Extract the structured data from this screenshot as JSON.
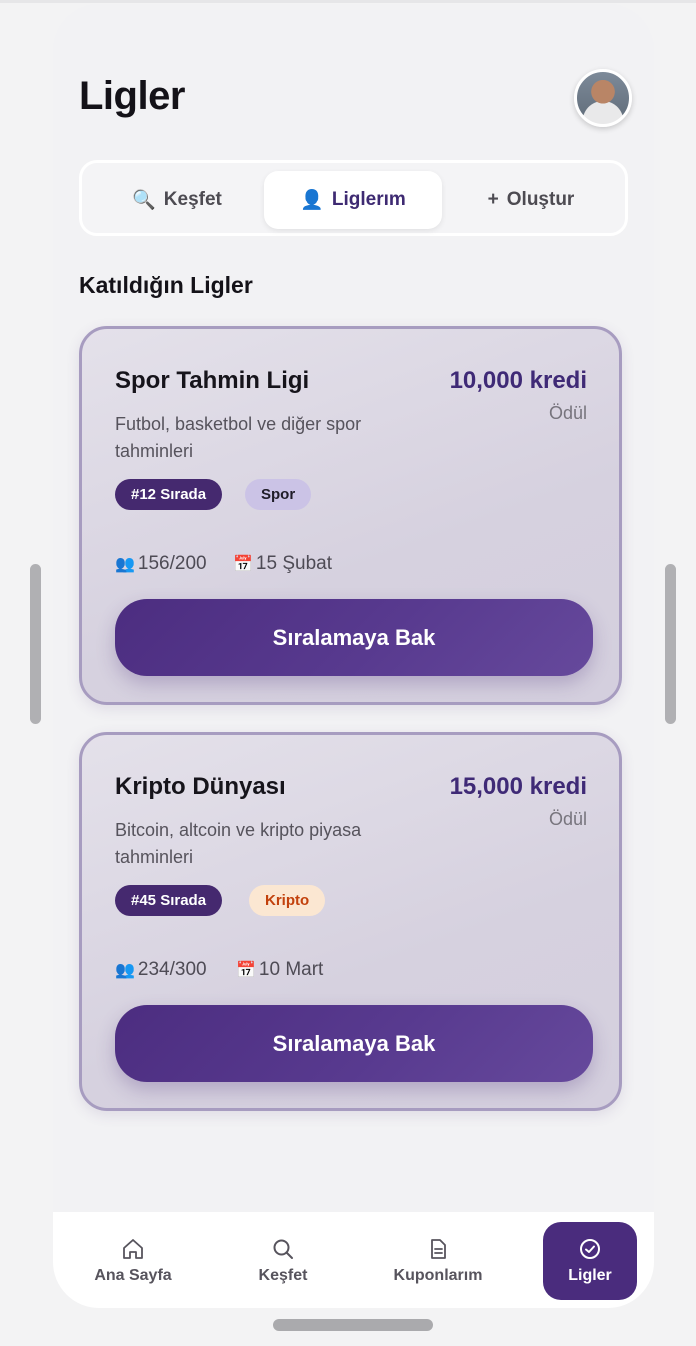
{
  "header": {
    "title": "Ligler"
  },
  "tabs": [
    {
      "icon": "🔍",
      "label": "Keşfet"
    },
    {
      "icon": "👤",
      "label": "Liglerım"
    },
    {
      "icon": "+",
      "label": "Oluştur"
    }
  ],
  "section": {
    "title": "Katıldığın Ligler"
  },
  "leagues": [
    {
      "name": "Spor Tahmin Ligi",
      "prize": "10,000 kredi",
      "prize_label": "Ödül",
      "description": "Futbol, basketbol ve diğer spor tahminleri",
      "rank": "#12 Sırada",
      "category": "Spor",
      "members_icon": "👥",
      "members": "156/200",
      "date_icon": "📅",
      "date": "15 Şubat",
      "button": "Sıralamaya Bak"
    },
    {
      "name": "Kripto Dünyası",
      "prize": "15,000 kredi",
      "prize_label": "Ödül",
      "description": "Bitcoin, altcoin ve kripto piyasa tahminleri",
      "rank": "#45 Sırada",
      "category": "Kripto",
      "members_icon": "👥",
      "members": "234/300",
      "date_icon": "📅",
      "date": "10 Mart",
      "button": "Sıralamaya Bak"
    }
  ],
  "bottom_nav": [
    {
      "label": "Ana Sayfa",
      "icon": "home-icon"
    },
    {
      "label": "Keşfet",
      "icon": "search-icon"
    },
    {
      "label": "Kuponlarım",
      "icon": "document-icon"
    },
    {
      "label": "Ligler",
      "icon": "badge-check-icon"
    }
  ],
  "colors": {
    "accent": "#4a2c7d",
    "card_border": "#a79cc0",
    "kripto_text": "#c2410c"
  }
}
